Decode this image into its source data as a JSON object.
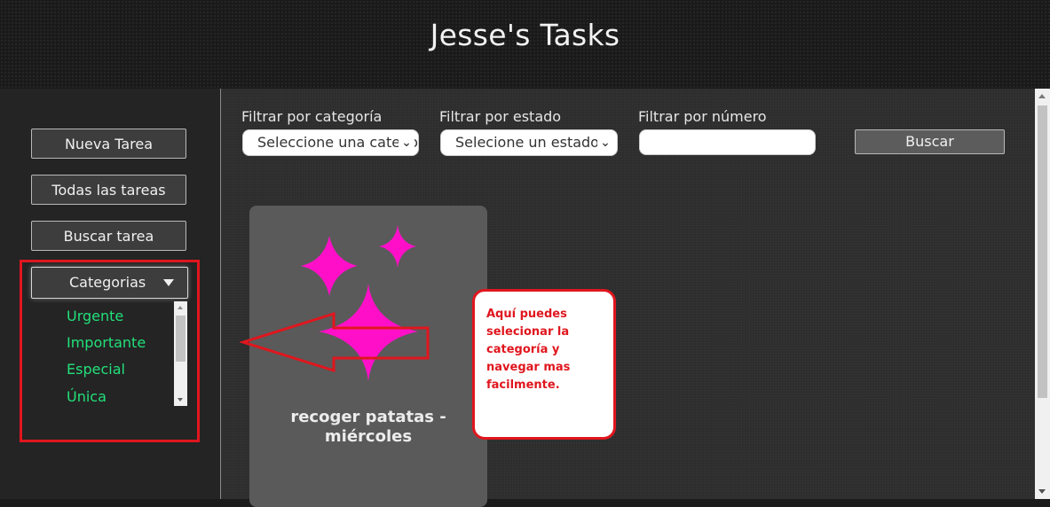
{
  "app": {
    "title": "Jesse's Tasks"
  },
  "sidebar": {
    "new_task": "Nueva Tarea",
    "all_tasks": "Todas las tareas",
    "search_task": "Buscar tarea",
    "categories_label": "Categorias",
    "categories": [
      "Urgente",
      "Importante",
      "Especial",
      "Única"
    ]
  },
  "filters": {
    "category_label": "Filtrar por categoría",
    "category_select": "Seleccione una categoría",
    "status_label": "Filtrar por estado",
    "status_select": "Selecione un estado",
    "number_label": "Filtrar por número",
    "number_value": "",
    "search_button": "Buscar"
  },
  "task_card": {
    "title": "recoger patatas - miércoles",
    "icon": "sparkles-icon",
    "icon_color": "#ff10c8"
  },
  "callout": {
    "text": "Aquí puedes selecionar la categoría y navegar mas facilmente."
  },
  "colors": {
    "highlight_red": "#e0161e",
    "category_green": "#22e07a"
  }
}
